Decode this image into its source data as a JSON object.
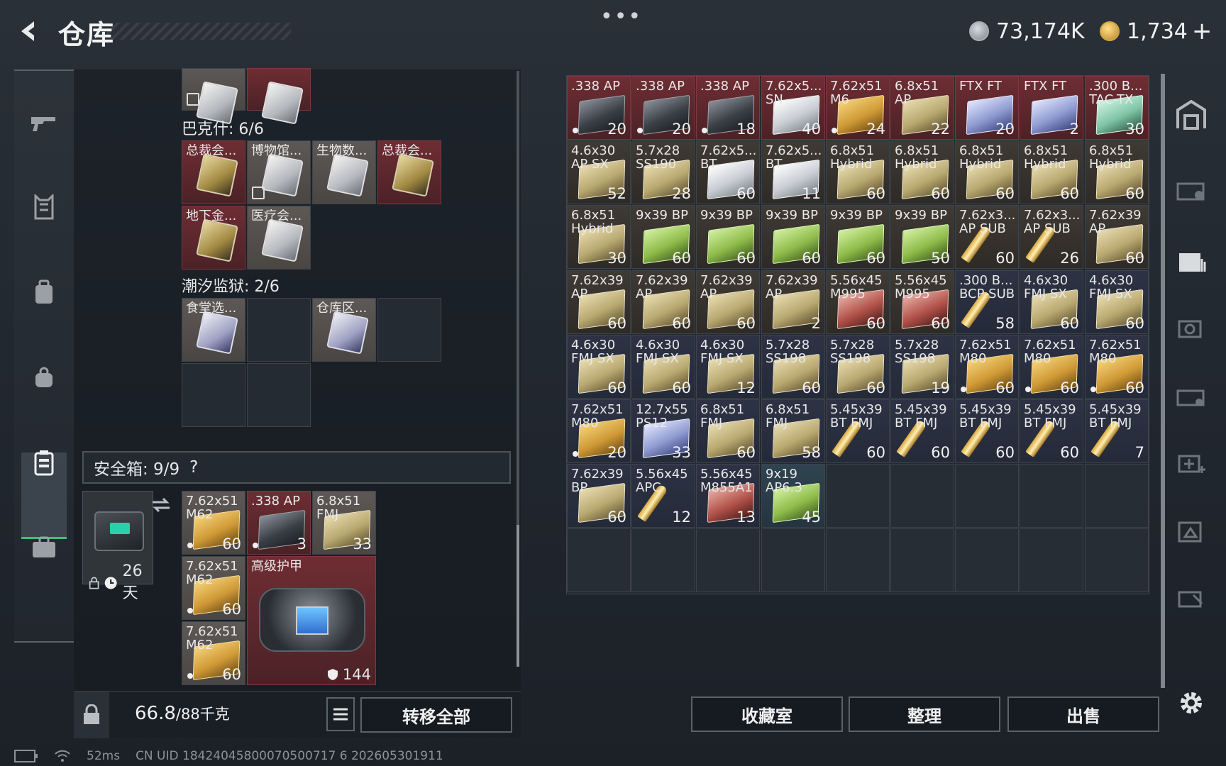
{
  "header": {
    "title": "仓库",
    "menu_glyph": "•••",
    "currency1": "73,174K",
    "currency2": "1,734",
    "plus": "+"
  },
  "left_panel": {
    "section1_label": "巴克什: 6/6",
    "section2_label": "潮汐监狱: 2/6",
    "top_partial": [
      {
        "label": "",
        "style": "gray",
        "art": "card-white",
        "locked": true
      },
      {
        "label": "",
        "style": "red",
        "art": "card-white"
      }
    ],
    "bakesh_items": [
      {
        "label": "总裁会...",
        "style": "red",
        "art": "card-gold"
      },
      {
        "label": "博物馆...",
        "style": "gray",
        "art": "card-white",
        "locked": true
      },
      {
        "label": "生物数...",
        "style": "gray",
        "art": "card-white"
      },
      {
        "label": "总裁会...",
        "style": "red",
        "art": "card-gold"
      },
      {
        "label": "地下金...",
        "style": "red",
        "art": "card-gold"
      },
      {
        "label": "医疗会...",
        "style": "gray",
        "art": "card-white"
      }
    ],
    "tide_items": [
      {
        "label": "食堂选...",
        "style": "gray",
        "art": "card-purple"
      },
      {
        "label": "",
        "style": "empty"
      },
      {
        "label": "仓库区...",
        "style": "gray",
        "art": "card-purple"
      },
      {
        "label": "",
        "style": "empty"
      },
      {
        "label": "",
        "style": "empty"
      },
      {
        "label": "",
        "style": "empty"
      }
    ],
    "safe_box": {
      "label": "安全箱: 9/9",
      "help": "?",
      "days": "26天",
      "items": [
        {
          "label": "7.62x51 M62",
          "count": "60",
          "dot": true,
          "style": "gray",
          "art": "a-gold"
        },
        {
          "label": ".338 AP",
          "count": "3",
          "dot": true,
          "style": "red",
          "art": "a-dark"
        },
        {
          "label": "6.8x51 FMJ",
          "count": "33",
          "style": "gray",
          "art": "a-tan"
        },
        {
          "label": "7.62x51 M62",
          "count": "60",
          "dot": true,
          "style": "gray",
          "art": "a-gold"
        },
        {
          "label": "7.62x51 M62",
          "count": "60",
          "dot": true,
          "style": "gray",
          "art": "a-gold"
        }
      ],
      "armor_bag": {
        "label": "高级护甲",
        "count": "144"
      }
    },
    "weight": "66.8",
    "weight_max": "/88千克",
    "transfer_all": "转移全部"
  },
  "stash_grid": [
    {
      "label": ".338 AP",
      "count": "20",
      "dot": true,
      "style": "red",
      "art": "a-dark"
    },
    {
      "label": ".338 AP",
      "count": "20",
      "dot": true,
      "style": "red",
      "art": "a-dark"
    },
    {
      "label": ".338 AP",
      "count": "18",
      "dot": true,
      "style": "red",
      "art": "a-dark"
    },
    {
      "label": "7.62x5... SN",
      "count": "40",
      "style": "red",
      "art": "a-white"
    },
    {
      "label": "7.62x51 M6",
      "count": "24",
      "dot": true,
      "style": "red",
      "art": "a-gold"
    },
    {
      "label": "6.8x51 AP",
      "count": "22",
      "style": "red",
      "art": "a-tan"
    },
    {
      "label": "FTX FT",
      "count": "20",
      "style": "red",
      "art": "a-blue"
    },
    {
      "label": "FTX FT",
      "count": "2",
      "style": "red",
      "art": "a-blue"
    },
    {
      "label": ".300 B... TAC-TX",
      "count": "30",
      "style": "red",
      "art": "a-mint"
    },
    {
      "label": "4.6x30 AP SX",
      "count": "52",
      "style": "brown",
      "art": "a-tan"
    },
    {
      "label": "5.7x28 SS190",
      "count": "28",
      "style": "brown",
      "art": "a-tan"
    },
    {
      "label": "7.62x5... BT",
      "count": "60",
      "style": "brown",
      "art": "a-white"
    },
    {
      "label": "7.62x5... BT",
      "count": "11",
      "style": "brown",
      "art": "a-white"
    },
    {
      "label": "6.8x51 Hybrid",
      "count": "60",
      "style": "brown",
      "art": "a-tan"
    },
    {
      "label": "6.8x51 Hybrid",
      "count": "60",
      "style": "brown",
      "art": "a-tan"
    },
    {
      "label": "6.8x51 Hybrid",
      "count": "60",
      "style": "brown",
      "art": "a-tan"
    },
    {
      "label": "6.8x51 Hybrid",
      "count": "60",
      "style": "brown",
      "art": "a-tan"
    },
    {
      "label": "6.8x51 Hybrid",
      "count": "60",
      "style": "brown",
      "art": "a-tan"
    },
    {
      "label": "6.8x51 Hybrid",
      "count": "30",
      "style": "brown",
      "art": "a-tan"
    },
    {
      "label": "9x39 BP",
      "count": "60",
      "style": "brown",
      "art": "a-green"
    },
    {
      "label": "9x39 BP",
      "count": "60",
      "style": "brown",
      "art": "a-green"
    },
    {
      "label": "9x39 BP",
      "count": "60",
      "style": "brown",
      "art": "a-green"
    },
    {
      "label": "9x39 BP",
      "count": "60",
      "style": "brown",
      "art": "a-green"
    },
    {
      "label": "9x39 BP",
      "count": "50",
      "style": "brown",
      "art": "a-green"
    },
    {
      "label": "7.62x3... AP SUB",
      "count": "60",
      "style": "brown",
      "art": "round"
    },
    {
      "label": "7.62x3... AP SUB",
      "count": "26",
      "style": "brown",
      "art": "round"
    },
    {
      "label": "7.62x39 AP",
      "count": "60",
      "style": "brown",
      "art": "a-tan"
    },
    {
      "label": "7.62x39 AP",
      "count": "60",
      "style": "brown",
      "art": "a-tan"
    },
    {
      "label": "7.62x39 AP",
      "count": "60",
      "style": "brown",
      "art": "a-tan"
    },
    {
      "label": "7.62x39 AP",
      "count": "60",
      "style": "brown",
      "art": "a-tan"
    },
    {
      "label": "7.62x39 AP",
      "count": "2",
      "style": "brown",
      "art": "a-tan"
    },
    {
      "label": "5.56x45 M995",
      "count": "60",
      "style": "brown",
      "art": "a-red"
    },
    {
      "label": "5.56x45 M995",
      "count": "60",
      "style": "brown",
      "art": "a-red"
    },
    {
      "label": ".300 B... BCP SUB",
      "count": "58",
      "style": "navy",
      "art": "round"
    },
    {
      "label": "4.6x30 FMJ SX",
      "count": "60",
      "style": "navy",
      "art": "a-tan"
    },
    {
      "label": "4.6x30 FMJ SX",
      "count": "60",
      "style": "navy",
      "art": "a-tan"
    },
    {
      "label": "4.6x30 FMJ SX",
      "count": "60",
      "style": "navy",
      "art": "a-tan"
    },
    {
      "label": "4.6x30 FMJ SX",
      "count": "60",
      "style": "navy",
      "art": "a-tan"
    },
    {
      "label": "4.6x30 FMJ SX",
      "count": "12",
      "style": "navy",
      "art": "a-tan"
    },
    {
      "label": "5.7x28 SS198",
      "count": "60",
      "style": "navy",
      "art": "a-tan"
    },
    {
      "label": "5.7x28 SS198",
      "count": "60",
      "style": "navy",
      "art": "a-tan"
    },
    {
      "label": "5.7x28 SS198",
      "count": "19",
      "style": "navy",
      "art": "a-tan"
    },
    {
      "label": "7.62x51 M80",
      "count": "60",
      "dot": true,
      "style": "navy",
      "art": "a-gold"
    },
    {
      "label": "7.62x51 M80",
      "count": "60",
      "dot": true,
      "style": "navy",
      "art": "a-gold"
    },
    {
      "label": "7.62x51 M80",
      "count": "60",
      "dot": true,
      "style": "navy",
      "art": "a-gold"
    },
    {
      "label": "7.62x51 M80",
      "count": "20",
      "dot": true,
      "style": "navy",
      "art": "a-gold"
    },
    {
      "label": "12.7x55 PS12",
      "count": "33",
      "style": "navy",
      "art": "a-blue"
    },
    {
      "label": "6.8x51 FMJ",
      "count": "60",
      "style": "navy",
      "art": "a-tan"
    },
    {
      "label": "6.8x51 FMJ",
      "count": "58",
      "style": "navy",
      "art": "a-tan"
    },
    {
      "label": "5.45x39 BT FMJ",
      "count": "60",
      "style": "navy",
      "art": "round"
    },
    {
      "label": "5.45x39 BT FMJ",
      "count": "60",
      "style": "navy",
      "art": "round"
    },
    {
      "label": "5.45x39 BT FMJ",
      "count": "60",
      "style": "navy",
      "art": "round"
    },
    {
      "label": "5.45x39 BT FMJ",
      "count": "60",
      "style": "navy",
      "art": "round"
    },
    {
      "label": "5.45x39 BT FMJ",
      "count": "7",
      "style": "navy",
      "art": "round"
    },
    {
      "label": "7.62x39 BP",
      "count": "60",
      "style": "navy",
      "art": "a-tan"
    },
    {
      "label": "5.56x45 APC",
      "count": "12",
      "style": "navy",
      "art": "round"
    },
    {
      "label": "5.56x45 M855A1",
      "count": "13",
      "style": "navy",
      "art": "a-red"
    },
    {
      "label": "9x19 AP6.3",
      "count": "45",
      "style": "teal",
      "art": "a-green"
    }
  ],
  "bottom_buttons": {
    "collect": "收藏室",
    "sort": "整理",
    "sell": "出售"
  },
  "status": {
    "ping": "52ms",
    "uid": "CN UID 18424045800070500717 6 202605301911"
  }
}
